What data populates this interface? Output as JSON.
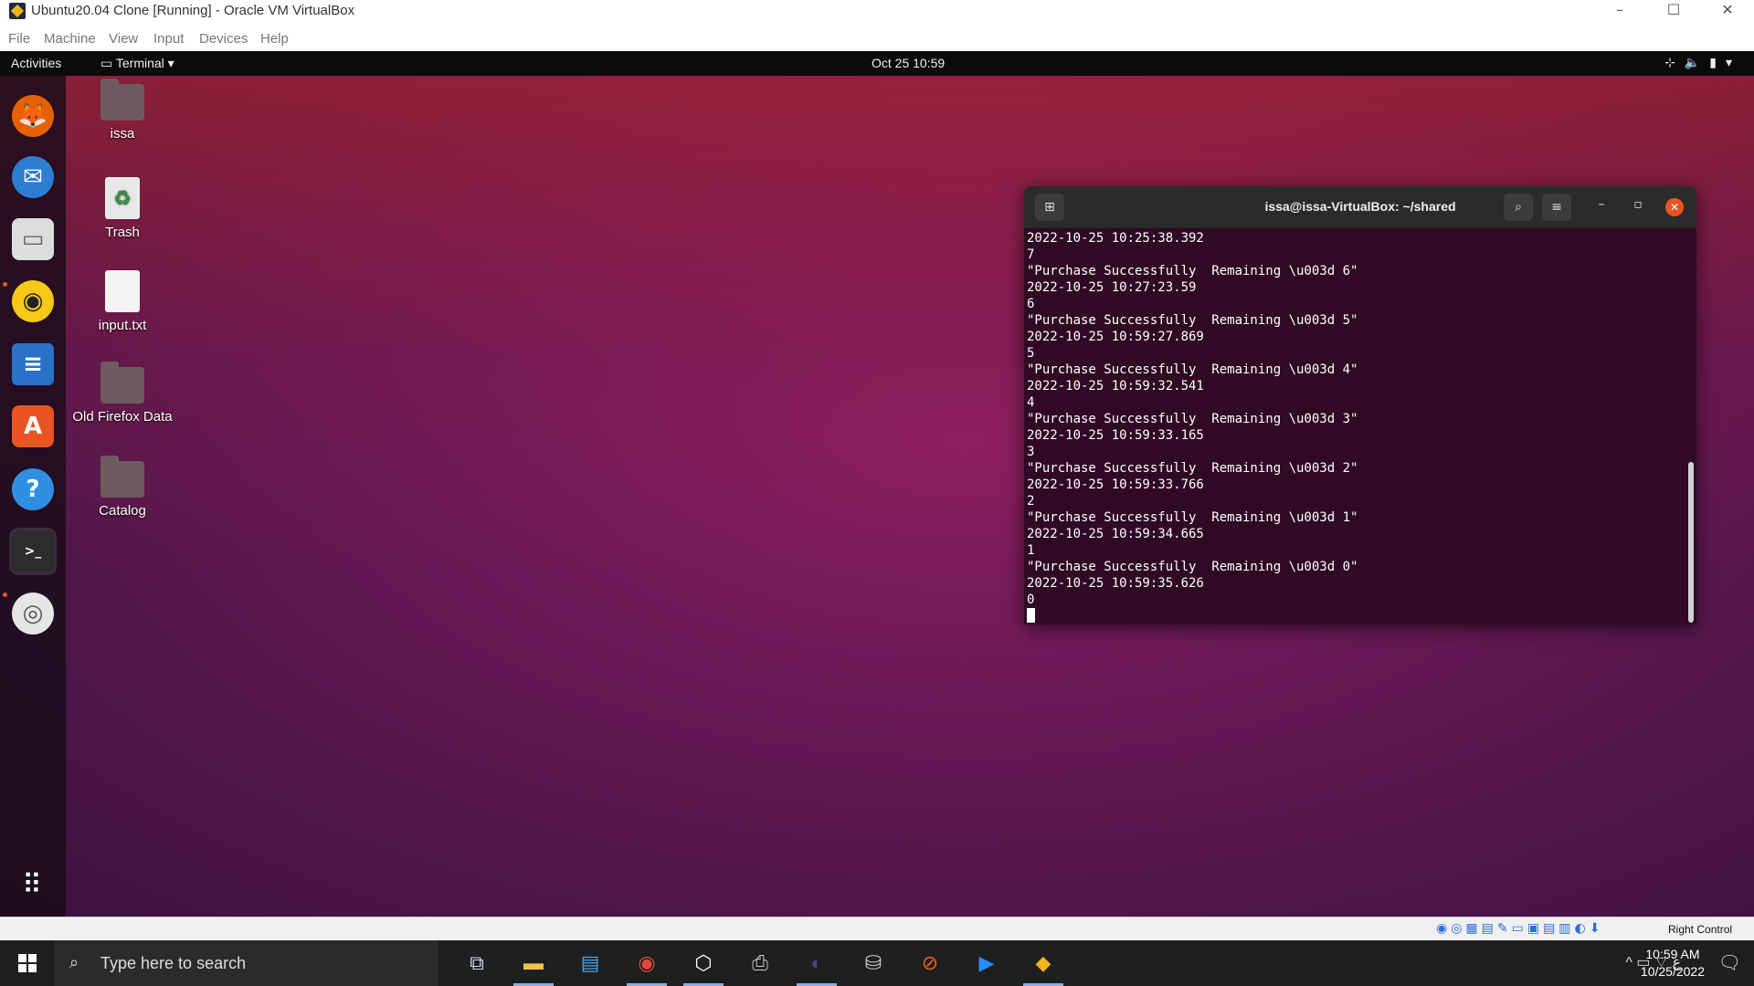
{
  "vbox": {
    "window_title": "Ubuntu20.04 Clone [Running] - Oracle VM VirtualBox",
    "controls": {
      "minimize": "–",
      "maximize": "☐",
      "close": "✕"
    },
    "menu": [
      "File",
      "Machine",
      "View",
      "Input",
      "Devices",
      "Help"
    ],
    "status_icons": "◉◎▦▤✎▭▣▤▥◐⬇",
    "host_key": "Right Control"
  },
  "gnome": {
    "activities": "Activities",
    "app_menu": "Terminal ▾",
    "clock": "Oct 25  10:59",
    "tray": "⊹🔈▮▾"
  },
  "dock": [
    {
      "name": "firefox",
      "glyph": "🦊",
      "color": "#e66000",
      "running": false
    },
    {
      "name": "thunderbird",
      "glyph": "✉",
      "color": "#2d7dd2",
      "running": false
    },
    {
      "name": "files",
      "glyph": "▭",
      "color": "#dddddd",
      "running": true
    },
    {
      "name": "rhythmbox",
      "glyph": "◉",
      "color": "#f6c915",
      "running": false
    },
    {
      "name": "libreoffice-writer",
      "glyph": "≡",
      "color": "#2a71c9",
      "running": false
    },
    {
      "name": "ubuntu-software",
      "glyph": "A",
      "color": "#e95420",
      "running": false
    },
    {
      "name": "help",
      "glyph": "?",
      "color": "#2f8fe0",
      "running": false
    },
    {
      "name": "terminal",
      "glyph": ">_",
      "color": "#2c2c2c",
      "running": true
    },
    {
      "name": "dvd",
      "glyph": "◎",
      "color": "#e6e6e6",
      "running": false
    }
  ],
  "desktop": {
    "icons": [
      {
        "label": "issa",
        "kind": "home-folder"
      },
      {
        "label": "Trash",
        "kind": "trash"
      },
      {
        "label": "input.txt",
        "kind": "text-file"
      },
      {
        "label": "Old Firefox Data",
        "kind": "folder"
      },
      {
        "label": "Catalog",
        "kind": "folder"
      }
    ]
  },
  "terminal": {
    "title": "issa@issa-VirtualBox: ~/shared",
    "lines": [
      "2022-10-25 10:25:38.392",
      "7",
      "\"Purchase Successfully  Remaining \\u003d 6\"",
      "2022-10-25 10:27:23.59",
      "6",
      "\"Purchase Successfully  Remaining \\u003d 5\"",
      "2022-10-25 10:59:27.869",
      "5",
      "\"Purchase Successfully  Remaining \\u003d 4\"",
      "2022-10-25 10:59:32.541",
      "4",
      "\"Purchase Successfully  Remaining \\u003d 3\"",
      "2022-10-25 10:59:33.165",
      "3",
      "\"Purchase Successfully  Remaining \\u003d 2\"",
      "2022-10-25 10:59:33.766",
      "2",
      "\"Purchase Successfully  Remaining \\u003d 1\"",
      "2022-10-25 10:59:34.665",
      "1",
      "\"Purchase Successfully  Remaining \\u003d 0\"",
      "2022-10-25 10:59:35.626",
      "0"
    ]
  },
  "taskbar": {
    "search_placeholder": "Type here to search",
    "apps": [
      {
        "name": "task-view",
        "glyph": "⧉",
        "color": "#cfd8e8",
        "active": false
      },
      {
        "name": "file-explorer",
        "glyph": "▬",
        "color": "#f2c14e",
        "active": true
      },
      {
        "name": "outlook",
        "glyph": "▤",
        "color": "#4aa0e6",
        "active": false
      },
      {
        "name": "chrome",
        "glyph": "◉",
        "color": "#e04a3a",
        "active": true
      },
      {
        "name": "virtualbox",
        "glyph": "⬡",
        "color": "#ffffff",
        "active": true
      },
      {
        "name": "printer",
        "glyph": "⎙",
        "color": "#cccccc",
        "active": false
      },
      {
        "name": "eclipse",
        "glyph": "◐",
        "color": "#4b3f8f",
        "active": true
      },
      {
        "name": "database",
        "glyph": "⛁",
        "color": "#cccccc",
        "active": false
      },
      {
        "name": "postman",
        "glyph": "⊘",
        "color": "#ef5b25",
        "active": false
      },
      {
        "name": "zoom",
        "glyph": "▶",
        "color": "#2d8cff",
        "active": false
      },
      {
        "name": "vm-window",
        "glyph": "◆",
        "color": "#f3b31a",
        "active": true
      }
    ],
    "tray": "^ ▭ ⌔ ع",
    "time": "10:59 AM",
    "date": "10/25/2022",
    "notification": "🗨"
  }
}
